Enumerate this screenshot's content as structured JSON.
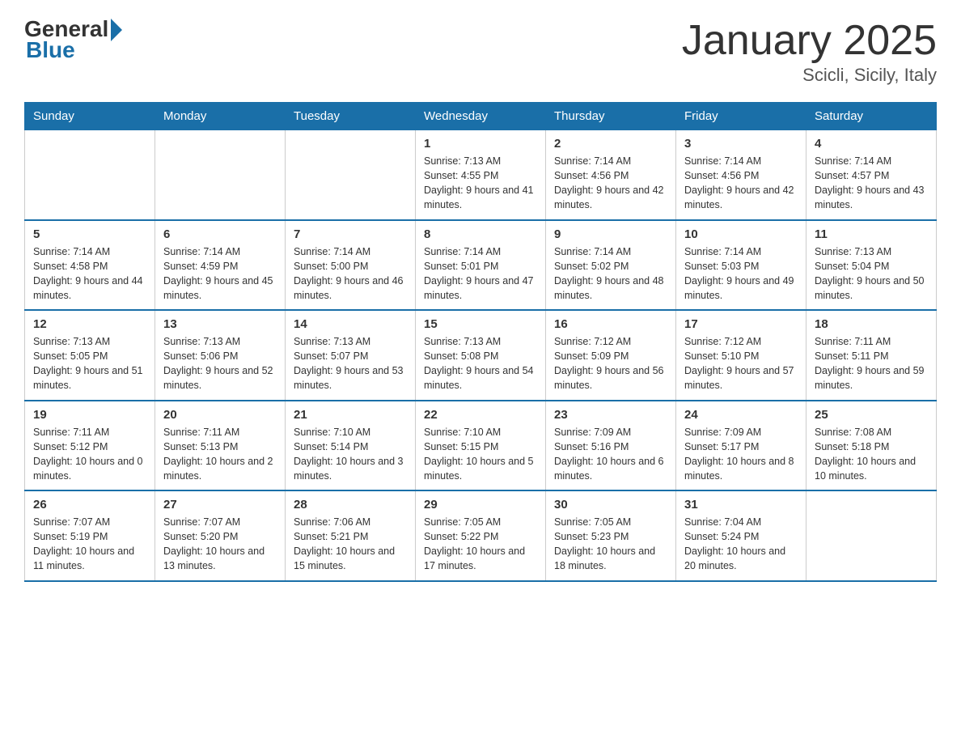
{
  "header": {
    "logo_general": "General",
    "logo_blue": "Blue",
    "title": "January 2025",
    "subtitle": "Scicli, Sicily, Italy"
  },
  "days_of_week": [
    "Sunday",
    "Monday",
    "Tuesday",
    "Wednesday",
    "Thursday",
    "Friday",
    "Saturday"
  ],
  "weeks": [
    [
      {
        "num": "",
        "info": ""
      },
      {
        "num": "",
        "info": ""
      },
      {
        "num": "",
        "info": ""
      },
      {
        "num": "1",
        "info": "Sunrise: 7:13 AM\nSunset: 4:55 PM\nDaylight: 9 hours and 41 minutes."
      },
      {
        "num": "2",
        "info": "Sunrise: 7:14 AM\nSunset: 4:56 PM\nDaylight: 9 hours and 42 minutes."
      },
      {
        "num": "3",
        "info": "Sunrise: 7:14 AM\nSunset: 4:56 PM\nDaylight: 9 hours and 42 minutes."
      },
      {
        "num": "4",
        "info": "Sunrise: 7:14 AM\nSunset: 4:57 PM\nDaylight: 9 hours and 43 minutes."
      }
    ],
    [
      {
        "num": "5",
        "info": "Sunrise: 7:14 AM\nSunset: 4:58 PM\nDaylight: 9 hours and 44 minutes."
      },
      {
        "num": "6",
        "info": "Sunrise: 7:14 AM\nSunset: 4:59 PM\nDaylight: 9 hours and 45 minutes."
      },
      {
        "num": "7",
        "info": "Sunrise: 7:14 AM\nSunset: 5:00 PM\nDaylight: 9 hours and 46 minutes."
      },
      {
        "num": "8",
        "info": "Sunrise: 7:14 AM\nSunset: 5:01 PM\nDaylight: 9 hours and 47 minutes."
      },
      {
        "num": "9",
        "info": "Sunrise: 7:14 AM\nSunset: 5:02 PM\nDaylight: 9 hours and 48 minutes."
      },
      {
        "num": "10",
        "info": "Sunrise: 7:14 AM\nSunset: 5:03 PM\nDaylight: 9 hours and 49 minutes."
      },
      {
        "num": "11",
        "info": "Sunrise: 7:13 AM\nSunset: 5:04 PM\nDaylight: 9 hours and 50 minutes."
      }
    ],
    [
      {
        "num": "12",
        "info": "Sunrise: 7:13 AM\nSunset: 5:05 PM\nDaylight: 9 hours and 51 minutes."
      },
      {
        "num": "13",
        "info": "Sunrise: 7:13 AM\nSunset: 5:06 PM\nDaylight: 9 hours and 52 minutes."
      },
      {
        "num": "14",
        "info": "Sunrise: 7:13 AM\nSunset: 5:07 PM\nDaylight: 9 hours and 53 minutes."
      },
      {
        "num": "15",
        "info": "Sunrise: 7:13 AM\nSunset: 5:08 PM\nDaylight: 9 hours and 54 minutes."
      },
      {
        "num": "16",
        "info": "Sunrise: 7:12 AM\nSunset: 5:09 PM\nDaylight: 9 hours and 56 minutes."
      },
      {
        "num": "17",
        "info": "Sunrise: 7:12 AM\nSunset: 5:10 PM\nDaylight: 9 hours and 57 minutes."
      },
      {
        "num": "18",
        "info": "Sunrise: 7:11 AM\nSunset: 5:11 PM\nDaylight: 9 hours and 59 minutes."
      }
    ],
    [
      {
        "num": "19",
        "info": "Sunrise: 7:11 AM\nSunset: 5:12 PM\nDaylight: 10 hours and 0 minutes."
      },
      {
        "num": "20",
        "info": "Sunrise: 7:11 AM\nSunset: 5:13 PM\nDaylight: 10 hours and 2 minutes."
      },
      {
        "num": "21",
        "info": "Sunrise: 7:10 AM\nSunset: 5:14 PM\nDaylight: 10 hours and 3 minutes."
      },
      {
        "num": "22",
        "info": "Sunrise: 7:10 AM\nSunset: 5:15 PM\nDaylight: 10 hours and 5 minutes."
      },
      {
        "num": "23",
        "info": "Sunrise: 7:09 AM\nSunset: 5:16 PM\nDaylight: 10 hours and 6 minutes."
      },
      {
        "num": "24",
        "info": "Sunrise: 7:09 AM\nSunset: 5:17 PM\nDaylight: 10 hours and 8 minutes."
      },
      {
        "num": "25",
        "info": "Sunrise: 7:08 AM\nSunset: 5:18 PM\nDaylight: 10 hours and 10 minutes."
      }
    ],
    [
      {
        "num": "26",
        "info": "Sunrise: 7:07 AM\nSunset: 5:19 PM\nDaylight: 10 hours and 11 minutes."
      },
      {
        "num": "27",
        "info": "Sunrise: 7:07 AM\nSunset: 5:20 PM\nDaylight: 10 hours and 13 minutes."
      },
      {
        "num": "28",
        "info": "Sunrise: 7:06 AM\nSunset: 5:21 PM\nDaylight: 10 hours and 15 minutes."
      },
      {
        "num": "29",
        "info": "Sunrise: 7:05 AM\nSunset: 5:22 PM\nDaylight: 10 hours and 17 minutes."
      },
      {
        "num": "30",
        "info": "Sunrise: 7:05 AM\nSunset: 5:23 PM\nDaylight: 10 hours and 18 minutes."
      },
      {
        "num": "31",
        "info": "Sunrise: 7:04 AM\nSunset: 5:24 PM\nDaylight: 10 hours and 20 minutes."
      },
      {
        "num": "",
        "info": ""
      }
    ]
  ]
}
